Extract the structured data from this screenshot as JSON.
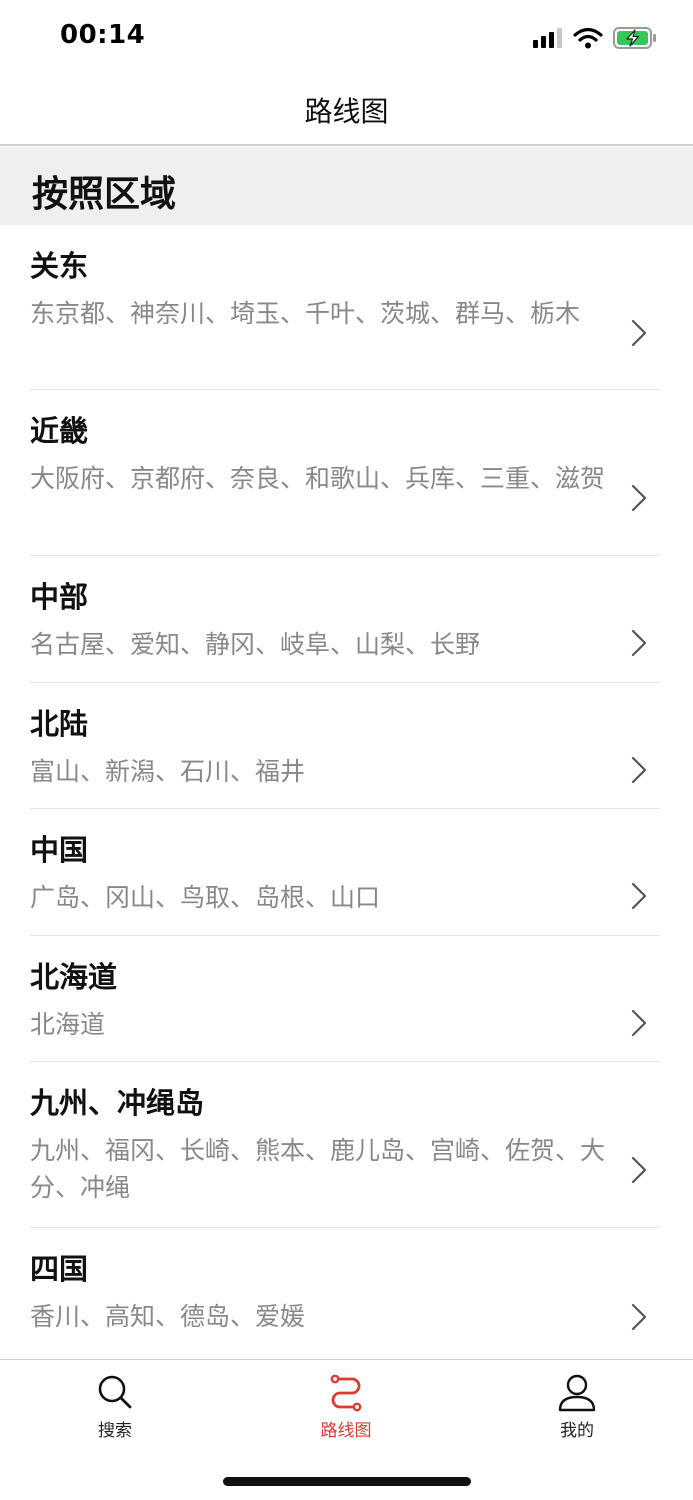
{
  "status_bar": {
    "time": "00:14"
  },
  "nav": {
    "title": "路线图"
  },
  "section": {
    "title": "按照区域"
  },
  "regions": [
    {
      "title": "关东",
      "subtitle": "东京都、神奈川、埼玉、千叶、茨城、群马、栃木"
    },
    {
      "title": "近畿",
      "subtitle": "大阪府、京都府、奈良、和歌山、兵库、三重、滋贺"
    },
    {
      "title": "中部",
      "subtitle": "名古屋、爱知、静冈、岐阜、山梨、长野"
    },
    {
      "title": "北陆",
      "subtitle": "富山、新潟、石川、福井"
    },
    {
      "title": "中国",
      "subtitle": "广岛、冈山、鸟取、岛根、山口"
    },
    {
      "title": "北海道",
      "subtitle": "北海道"
    },
    {
      "title": "九州、冲绳岛",
      "subtitle": "九州、福冈、长崎、熊本、鹿儿岛、宫崎、佐贺、大分、冲绳"
    },
    {
      "title": "四国",
      "subtitle": "香川、高知、德岛、爱媛"
    }
  ],
  "tabs": [
    {
      "label": "搜索",
      "icon": "search-icon"
    },
    {
      "label": "路线图",
      "icon": "route-map-icon",
      "active": true
    },
    {
      "label": "我的",
      "icon": "person-icon"
    }
  ],
  "colors": {
    "accent": "#e03a2f",
    "battery": "#34c759",
    "subtitle_text": "#888888",
    "section_bg": "#efefef"
  }
}
